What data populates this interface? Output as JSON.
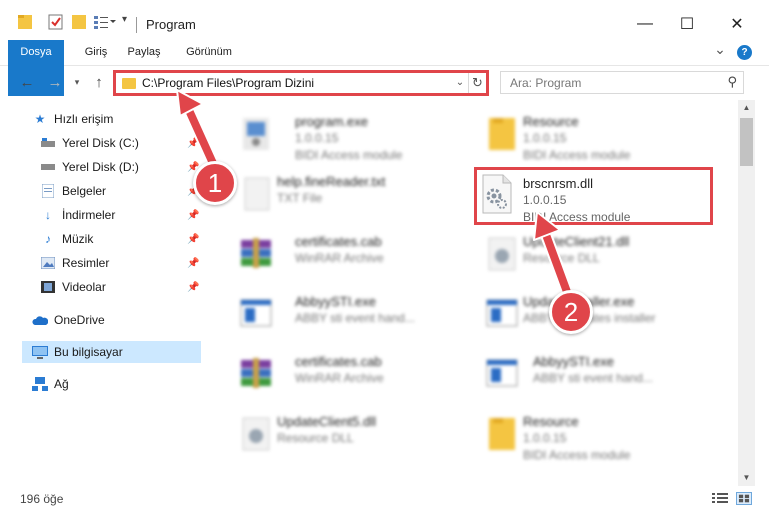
{
  "window": {
    "title": "Program",
    "minimize": "—",
    "maximize": "☐",
    "close": "✕"
  },
  "ribbon": {
    "tabs": [
      "Dosya",
      "Giriş",
      "Paylaş",
      "Görünüm"
    ],
    "expand": "⌄",
    "help": "?"
  },
  "address": {
    "path": "C:\\Program Files\\Program Dizini",
    "search_placeholder": "Ara: Program"
  },
  "nav": {
    "quick_access": "Hızlı erişim",
    "items": [
      {
        "label": "Yerel Disk (C:)"
      },
      {
        "label": "Yerel Disk (D:)"
      },
      {
        "label": "Belgeler"
      },
      {
        "label": "İndirmeler"
      },
      {
        "label": "Müzik"
      },
      {
        "label": "Resimler"
      },
      {
        "label": "Videolar"
      }
    ],
    "onedrive": "OneDrive",
    "this_pc": "Bu bilgisayar",
    "network": "Ağ"
  },
  "files": [
    {
      "name": "program.exe",
      "line1": "1.0.0.15",
      "line2": "BIDI Access module",
      "icon": "exe"
    },
    {
      "name": "Resource",
      "line1": "1.0.0.15",
      "line2": "BIDI Access module",
      "icon": "folder"
    },
    {
      "name": "help.fineReader.txt",
      "line1": "TXT File",
      "line2": "",
      "icon": "txt"
    },
    {
      "name": "brscnrsm.dll",
      "line1": "1.0.0.15",
      "line2": "BIDI Access module",
      "icon": "dll"
    },
    {
      "name": "certificates.cab",
      "line1": "WinRAR Archive",
      "line2": "",
      "icon": "rar"
    },
    {
      "name": "UpdateClient21.dll",
      "line1": "Resource DLL",
      "line2": "",
      "icon": "dll"
    },
    {
      "name": "AbbyySTI.exe",
      "line1": "ABBY sti event hand...",
      "line2": "",
      "icon": "app"
    },
    {
      "name": "UpdateInstaller.exe",
      "line1": "ABBYY Updates installer",
      "line2": "",
      "icon": "app"
    },
    {
      "name": "certificates.cab",
      "line1": "WinRAR Archive",
      "line2": "",
      "icon": "rar"
    },
    {
      "name": "AbbyySTI.exe",
      "line1": "ABBY sti event hand...",
      "line2": "",
      "icon": "app"
    },
    {
      "name": "UpdateClient5.dll",
      "line1": "Resource DLL",
      "line2": "",
      "icon": "dll"
    },
    {
      "name": "Resource",
      "line1": "1.0.0.15",
      "line2": "BIDI Access module",
      "icon": "folder"
    }
  ],
  "status": {
    "count": "196 öğe"
  },
  "annotations": [
    "1",
    "2"
  ],
  "colors": {
    "accent": "#1979ca",
    "highlight": "#e0454a",
    "selected": "#cce8ff"
  }
}
